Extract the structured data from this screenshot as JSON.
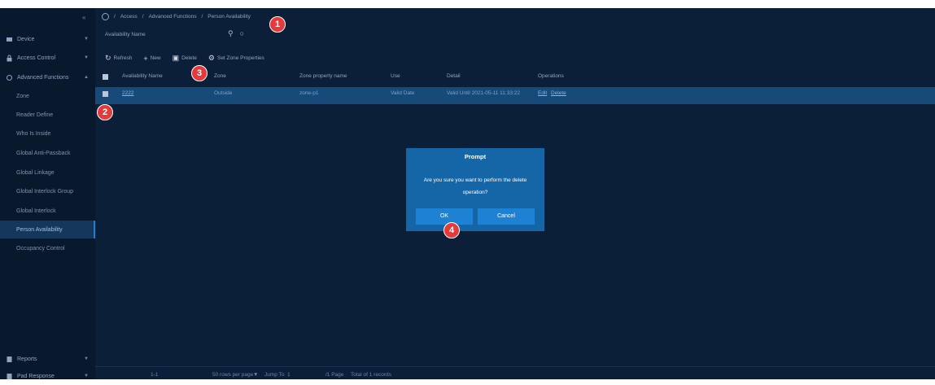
{
  "sidebar": {
    "collapse_glyph": "«",
    "sections": [
      {
        "label": "Device",
        "icon": "device-icon"
      },
      {
        "label": "Access Control",
        "icon": "lock-icon"
      },
      {
        "label": "Advanced Functions",
        "icon": "advanced-icon"
      }
    ],
    "sub_items": [
      "Zone",
      "Reader Define",
      "Who Is Inside",
      "Global Anti-Passback",
      "Global Linkage",
      "Global Interlock Group",
      "Global Interlock",
      "Person Availability",
      "Occupancy Control"
    ],
    "active_item": "Person Availability",
    "bottom": [
      {
        "label": "Reports",
        "icon": "reports-icon"
      },
      {
        "label": "Pad Response",
        "icon": "pad-icon"
      }
    ]
  },
  "breadcrumb": {
    "items": [
      "Access",
      "Advanced Functions",
      "Person Availability"
    ],
    "sep": "/"
  },
  "search": {
    "label": "Availability Name",
    "search_glyph": "⚲",
    "refresh_glyph": "○"
  },
  "toolbar": {
    "refresh": "Refresh",
    "new": "New",
    "delete": "Delete",
    "set_zone": "Set Zone Properties"
  },
  "table": {
    "headers": [
      "Availability Name",
      "Zone",
      "Zone property name",
      "Use",
      "Detail",
      "Operations"
    ],
    "row": {
      "name": "2222",
      "zone": "Outside",
      "zone_property": "zone-p1",
      "use": "Valid Date",
      "detail": "Valid Until 2021-05-11 11:33:22",
      "edit": "Edit",
      "delete": "Delete"
    }
  },
  "footer": {
    "range": "1-1",
    "per_page": "50 rows per page",
    "jump_to": "Jump To",
    "page": "1",
    "pages": "/1 Page",
    "total": "Total of 1 records"
  },
  "dialog": {
    "title": "Prompt",
    "message": "Are you sure you want to perform the delete operation?",
    "ok": "OK",
    "cancel": "Cancel"
  },
  "markers": [
    "1",
    "2",
    "3",
    "4"
  ]
}
